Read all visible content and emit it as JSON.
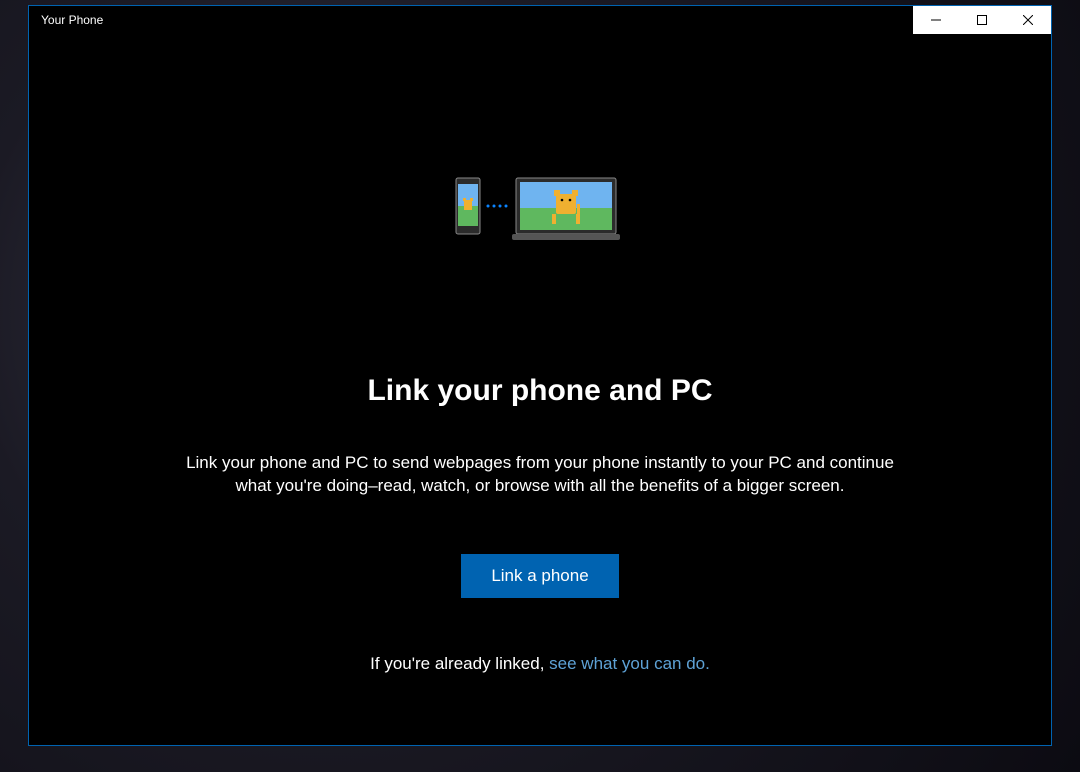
{
  "window": {
    "title": "Your Phone"
  },
  "caption": {
    "minimize": "Minimize",
    "maximize": "Maximize",
    "close": "Close"
  },
  "illustration": {
    "phone_icon": "phone-device-icon",
    "laptop_icon": "laptop-device-icon",
    "link_dots": "link-dots-icon"
  },
  "main": {
    "heading": "Link your phone and PC",
    "description": "Link your phone and PC to send webpages from your phone instantly to your PC and continue what you're doing–read, watch, or browse with all the benefits of a bigger screen.",
    "cta_label": "Link a phone",
    "already_prefix": "If you're already linked, ",
    "already_link": "see what you can do."
  },
  "colors": {
    "accent": "#0063b1",
    "link": "#5ea2d6",
    "bg": "#000000",
    "fg": "#ffffff"
  }
}
